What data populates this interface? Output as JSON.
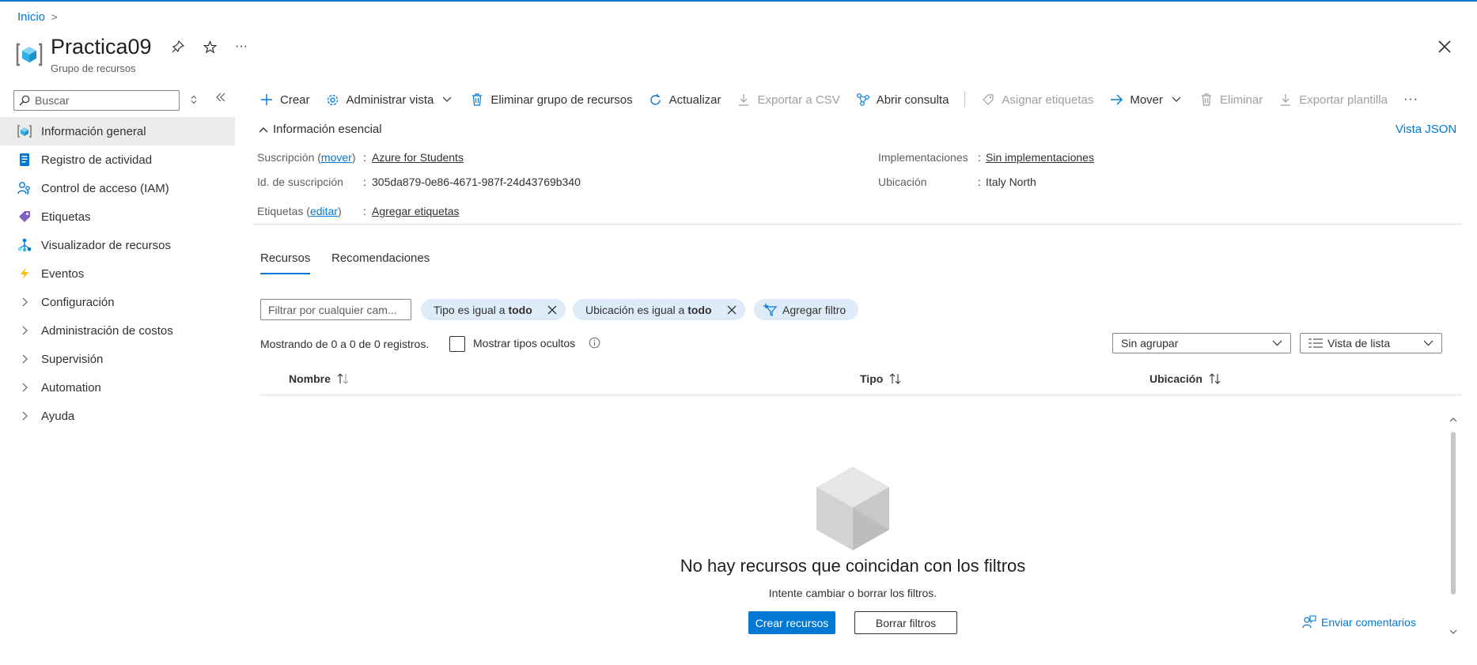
{
  "breadcrumb": {
    "home": "Inicio",
    "separator": ">"
  },
  "header": {
    "title": "Practica09",
    "subtitle": "Grupo de recursos",
    "more": "···"
  },
  "sidebar": {
    "search_placeholder": "Buscar",
    "items": [
      {
        "label": "Información general",
        "icon": "overview-icon",
        "active": true
      },
      {
        "label": "Registro de actividad",
        "icon": "activity-log-icon"
      },
      {
        "label": "Control de acceso (IAM)",
        "icon": "iam-icon"
      },
      {
        "label": "Etiquetas",
        "icon": "tag-icon"
      },
      {
        "label": "Visualizador de recursos",
        "icon": "resource-visualizer-icon"
      },
      {
        "label": "Eventos",
        "icon": "lightning-icon"
      },
      {
        "label": "Configuración",
        "expandable": true
      },
      {
        "label": "Administración de costos",
        "expandable": true
      },
      {
        "label": "Supervisión",
        "expandable": true
      },
      {
        "label": "Automation",
        "expandable": true
      },
      {
        "label": "Ayuda",
        "expandable": true
      }
    ]
  },
  "toolbar": {
    "crear": "Crear",
    "administrar_vista": "Administrar vista",
    "eliminar_grupo": "Eliminar grupo de recursos",
    "actualizar": "Actualizar",
    "exportar_csv": "Exportar a CSV",
    "abrir_consulta": "Abrir consulta",
    "asignar_etiquetas": "Asignar etiquetas",
    "mover": "Mover",
    "eliminar": "Eliminar",
    "exportar_plantilla": "Exportar plantilla",
    "more": "···"
  },
  "essentials": {
    "toggle_label": "Información esencial",
    "json_view": "Vista JSON",
    "suscripcion_label": "Suscripción (",
    "suscripcion_mover": "mover",
    "suscripcion_close": ")",
    "suscripcion_value": "Azure for Students",
    "id_label": "Id. de suscripción",
    "id_value": "305da879-0e86-4671-987f-24d43769b340",
    "etiquetas_label": "Etiquetas (",
    "etiquetas_editar": "editar",
    "etiquetas_close": ")",
    "etiquetas_value": "Agregar etiquetas",
    "implementaciones_label": "Implementaciones",
    "implementaciones_value": "Sin implementaciones",
    "ubicacion_label": "Ubicación",
    "ubicacion_value": "Italy North",
    "colon": ":"
  },
  "tabs": {
    "recursos": "Recursos",
    "recomendaciones": "Recomendaciones"
  },
  "filters": {
    "placeholder": "Filtrar por cualquier cam...",
    "tipo_prefix": "Tipo es igual a ",
    "tipo_value": "todo",
    "ubicacion_prefix": "Ubicación es igual a ",
    "ubicacion_value": "todo",
    "add_filter": "Agregar filtro"
  },
  "list": {
    "showing": "Mostrando de 0 a 0 de 0 registros.",
    "show_hidden": "Mostrar tipos ocultos",
    "group_by": "Sin agrupar",
    "view_mode": "Vista de lista",
    "columns": {
      "nombre": "Nombre",
      "tipo": "Tipo",
      "ubicacion": "Ubicación"
    }
  },
  "empty": {
    "title": "No hay recursos que coincidan con los filtros",
    "subtitle": "Intente cambiar o borrar los filtros.",
    "create_button": "Crear recursos",
    "clear_button": "Borrar filtros"
  },
  "feedback": "Enviar comentarios",
  "colors": {
    "accent": "#0078d4",
    "pill_bg": "#deecf9",
    "active_nav": "#edebe9"
  }
}
